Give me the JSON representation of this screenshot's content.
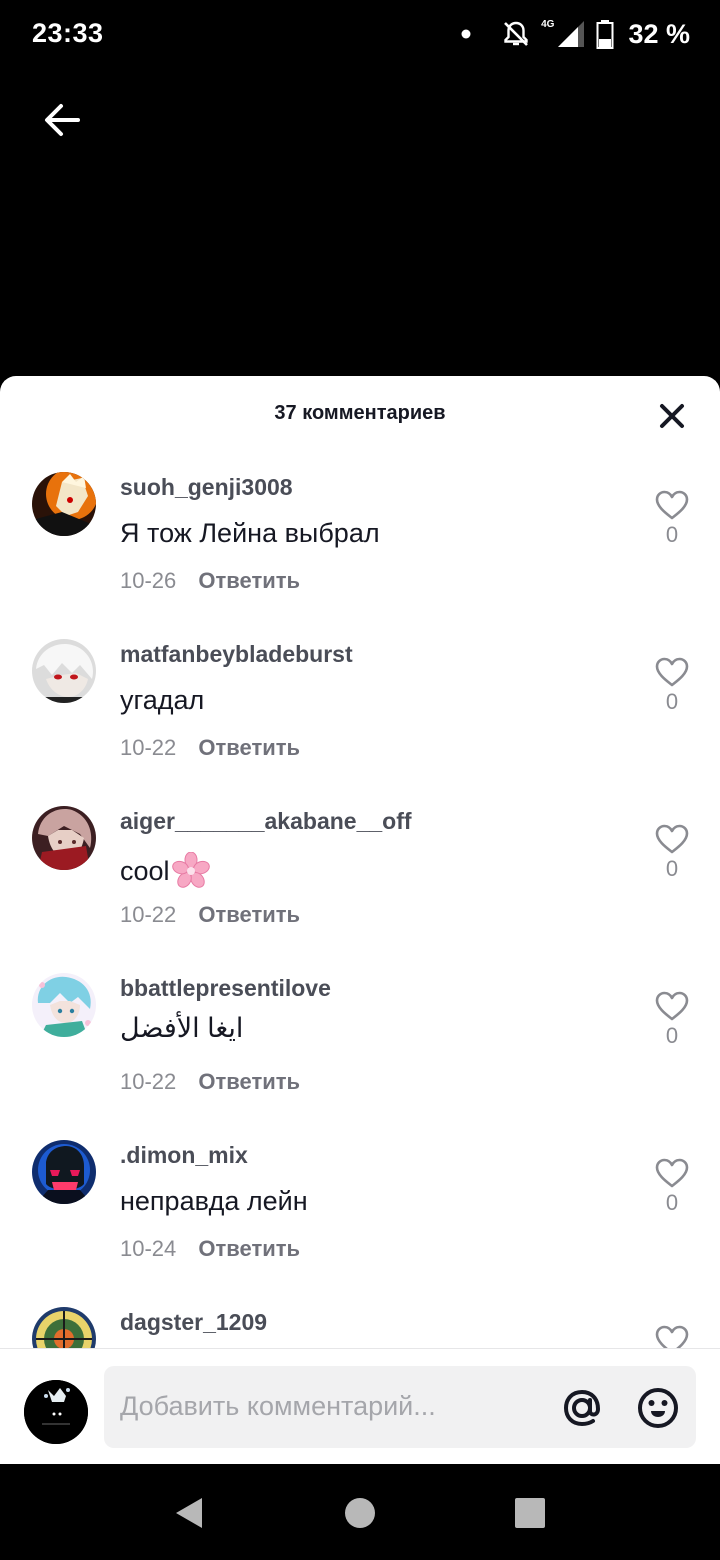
{
  "status_bar": {
    "time": "23:33",
    "network": "4G",
    "battery": "32 %"
  },
  "sheet": {
    "title": "37 комментариев"
  },
  "comments": [
    {
      "username": "suoh_genji3008",
      "text": "Я тож Лейна выбрал",
      "date": "10-26",
      "reply_label": "Ответить",
      "likes": "0"
    },
    {
      "username": "matfanbeybladeburst",
      "text": "угадал",
      "date": "10-22",
      "reply_label": "Ответить",
      "likes": "0"
    },
    {
      "username": "aiger_______akabane__off",
      "text": "cool",
      "date": "10-22",
      "reply_label": "Ответить",
      "likes": "0"
    },
    {
      "username": "bbattlepresentilove",
      "text": "ايغا الأفضل",
      "date": "10-22",
      "reply_label": "Ответить",
      "likes": "0"
    },
    {
      "username": ".dimon_mix",
      "text": "неправда лейн",
      "date": "10-24",
      "reply_label": "Ответить",
      "likes": "0"
    },
    {
      "username": "dagster_1209",
      "text": "",
      "date": "",
      "reply_label": "",
      "likes": ""
    }
  ],
  "input": {
    "placeholder": "Добавить комментарий..."
  },
  "colors": {
    "sheet_bg": "#ffffff",
    "text_primary": "#161823",
    "text_secondary": "#8a8b91",
    "field_bg": "#f1f1f2"
  }
}
